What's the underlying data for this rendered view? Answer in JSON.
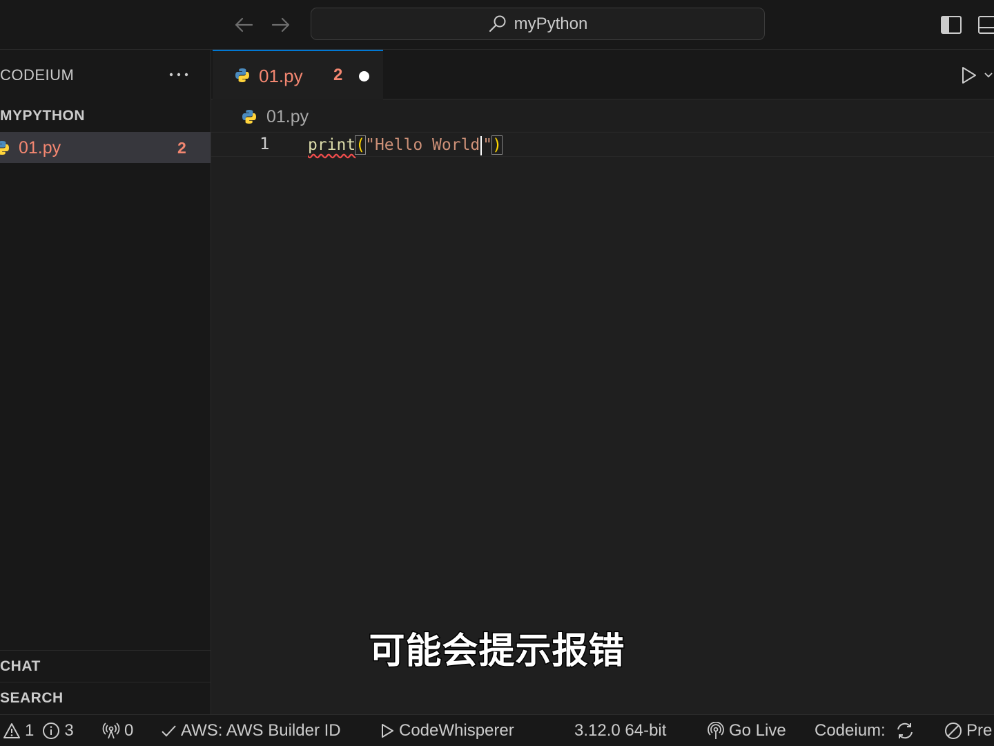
{
  "titlebar": {
    "search_text": "myPython"
  },
  "sidebar": {
    "title": "CODEIUM",
    "folder_name": "MYPYTHON",
    "files": [
      {
        "name": "01.py",
        "problems": "2"
      }
    ],
    "sections": {
      "chat": "CHAT",
      "search": "SEARCH"
    }
  },
  "tabs": [
    {
      "name": "01.py",
      "problems": "2"
    }
  ],
  "breadcrumb": {
    "file": "01.py"
  },
  "editor": {
    "line_number": "1",
    "code": {
      "fn": "print",
      "open": "(",
      "str_before_cursor": "\"Hello World",
      "str_after_cursor": "\"",
      "close": ")"
    }
  },
  "subtitle": "可能会提示报错",
  "statusbar": {
    "warnings": "1",
    "infos": "3",
    "ports": "0",
    "aws": "AWS: AWS Builder ID",
    "codewhisperer": "CodeWhisperer",
    "python_version": "3.12.0 64-bit",
    "go_live": "Go Live",
    "codeium": "Codeium:",
    "prettier": "Pre"
  },
  "colors": {
    "accent": "#0078d4",
    "error_text": "#f48771",
    "python_blue": "#4b8bbe",
    "python_yellow": "#ffd43b"
  }
}
